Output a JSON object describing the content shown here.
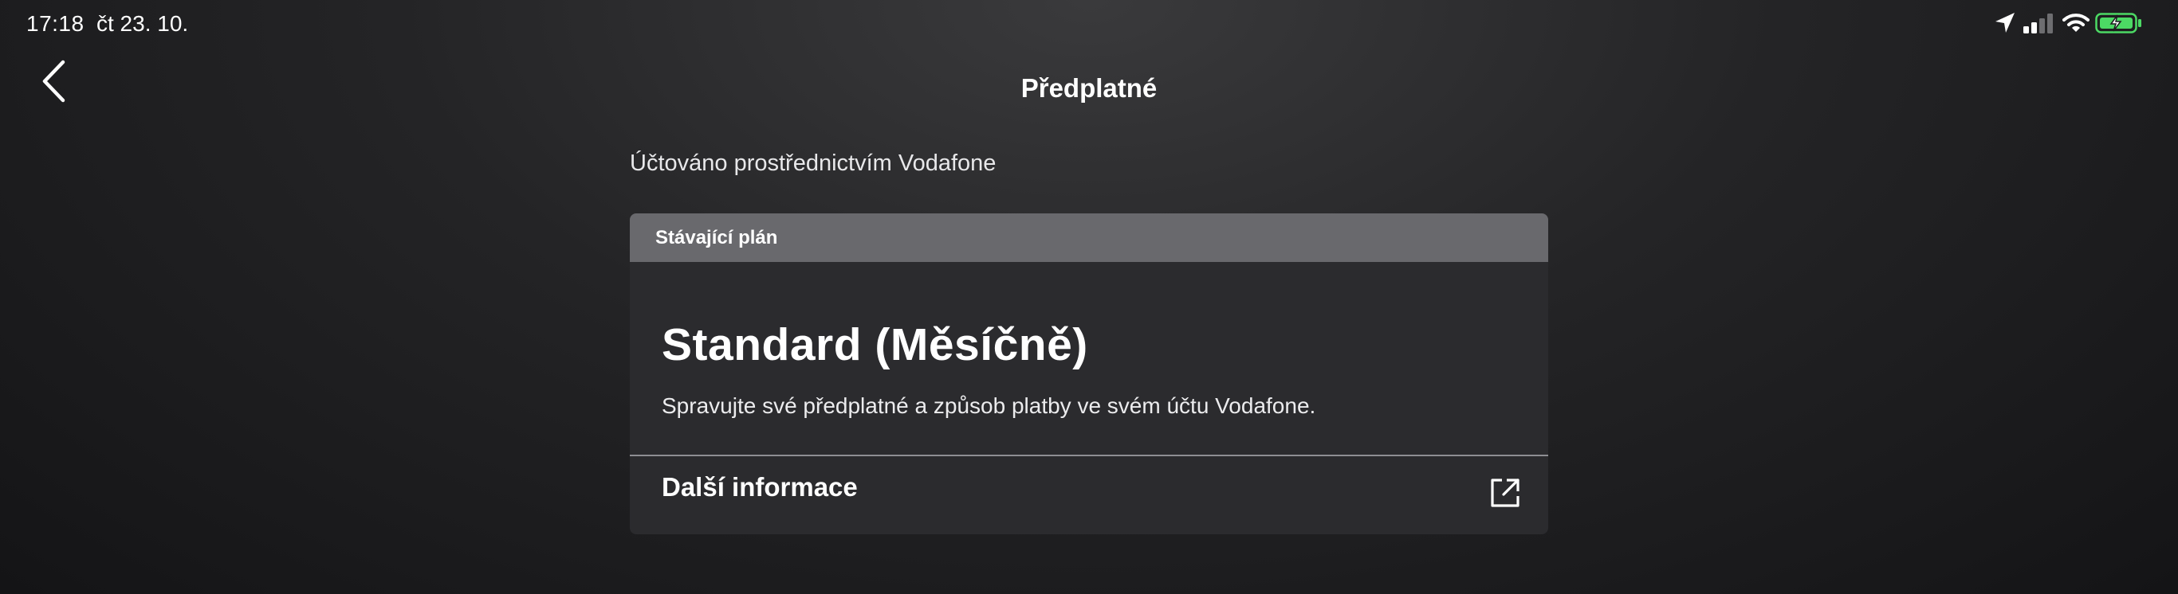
{
  "status_bar": {
    "time": "17:18",
    "date": "čt 23. 10.",
    "icons": [
      "location-icon",
      "signal-icon",
      "wifi-icon",
      "battery-charging-icon"
    ],
    "battery_color": "#4cd964"
  },
  "header": {
    "back_icon": "chevron-left-icon",
    "title": "Předplatné"
  },
  "billing": {
    "note": "Účtováno prostřednictvím Vodafone"
  },
  "plan_card": {
    "header_label": "Stávající plán",
    "plan_name": "Standard (Měsíčně)",
    "description": "Spravujte své předplatné a způsob platby ve svém účtu Vodafone.",
    "more_label": "Další informace",
    "more_icon": "external-link-icon",
    "header_bg": "#69696d",
    "card_bg": "#2b2b2e"
  }
}
